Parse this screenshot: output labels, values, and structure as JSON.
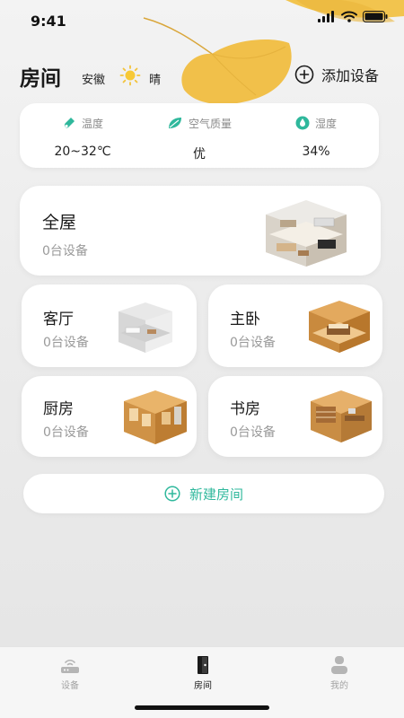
{
  "status_bar": {
    "time": "9:41"
  },
  "header": {
    "title": "房间",
    "city": "安徽",
    "weather": "晴",
    "weather_icon": "sun-icon",
    "add_device_label": "添加设备",
    "add_device_icon": "plus-circle-icon"
  },
  "environment": {
    "temperature": {
      "label": "温度",
      "value": "20~32℃",
      "icon": "thermometer-icon"
    },
    "air_quality": {
      "label": "空气质量",
      "value": "优",
      "icon": "leaf-icon"
    },
    "humidity": {
      "label": "湿度",
      "value": "34%",
      "icon": "droplet-icon"
    }
  },
  "rooms": {
    "whole_house": {
      "name": "全屋",
      "count": "0台设备"
    },
    "living_room": {
      "name": "客厅",
      "count": "0台设备"
    },
    "master_bedroom": {
      "name": "主卧",
      "count": "0台设备"
    },
    "kitchen": {
      "name": "厨房",
      "count": "0台设备"
    },
    "study": {
      "name": "书房",
      "count": "0台设备"
    }
  },
  "new_room": {
    "label": "新建房间",
    "icon": "plus-circle-icon"
  },
  "tabs": [
    {
      "label": "设备",
      "icon": "router-icon",
      "active": false
    },
    {
      "label": "房间",
      "icon": "door-icon",
      "active": true
    },
    {
      "label": "我的",
      "icon": "person-icon",
      "active": false
    }
  ],
  "colors": {
    "accent": "#2fb89c",
    "leaf": "#f0c24a"
  }
}
